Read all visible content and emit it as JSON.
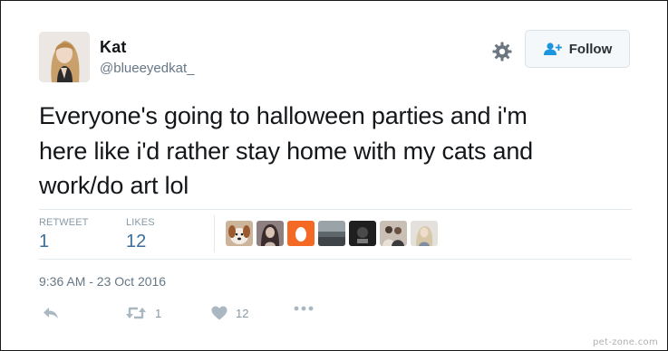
{
  "user": {
    "name": "Kat",
    "handle": "@blueeyedkat_"
  },
  "header": {
    "follow_label": "Follow"
  },
  "tweet": {
    "lines": [
      "Everyone's going to halloween parties and i'm",
      "here like i'd rather stay home with my cats and",
      "work/do art lol"
    ]
  },
  "stats": {
    "retweets_label": "RETWEET",
    "retweets_value": "1",
    "likes_label": "LIKES",
    "likes_value": "12"
  },
  "likers": [
    {
      "icon": "dog-avatar",
      "color": "#c9a07a"
    },
    {
      "icon": "woman-avatar",
      "color": "#7a6b6b"
    },
    {
      "icon": "egg-avatar",
      "color": "#f46a24"
    },
    {
      "icon": "landscape-avatar",
      "color": "#6f7a80"
    },
    {
      "icon": "dark-avatar",
      "color": "#2d2d2d"
    },
    {
      "icon": "people-avatar",
      "color": "#b7aaa0"
    },
    {
      "icon": "girl-avatar",
      "color": "#d9d6d1"
    }
  ],
  "timestamp": "9:36 AM - 23 Oct 2016",
  "actions": {
    "retweet_count": "1",
    "like_count": "12"
  },
  "watermark": "pet-zone.com",
  "colors": {
    "link_blue": "#3b6e9c",
    "muted": "#657786",
    "light_muted": "#aab8c2",
    "divider": "#e1e8ed"
  }
}
